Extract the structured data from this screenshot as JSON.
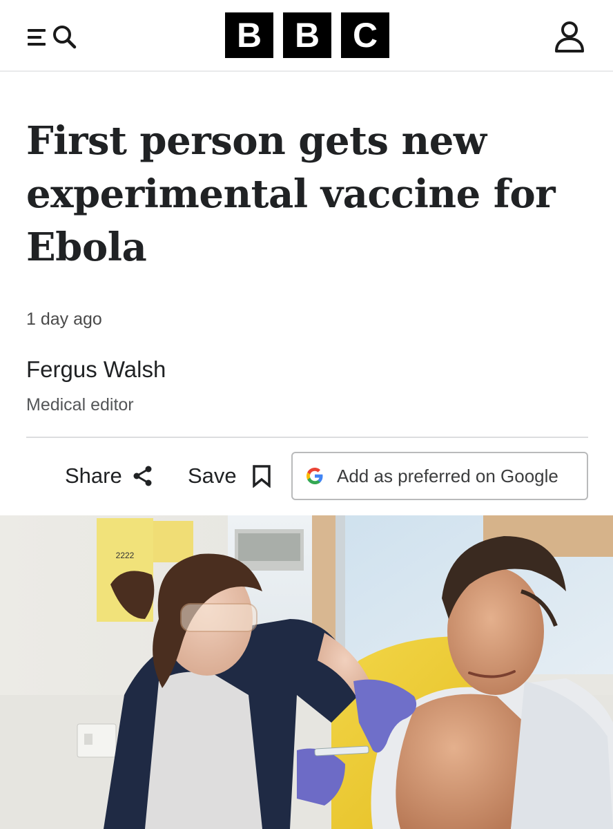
{
  "header": {
    "menu_icon": "hamburger-menu-icon",
    "search_icon": "search-icon",
    "logo_letters": [
      "B",
      "B",
      "C"
    ],
    "account_icon": "user-account-icon"
  },
  "article": {
    "headline": "First person gets new experimental vaccine for Ebola",
    "timestamp": "1 day ago",
    "author_name": "Fergus Walsh",
    "author_role": "Medical editor"
  },
  "actions": {
    "share_label": "Share",
    "share_icon": "share-icon",
    "save_label": "Save",
    "save_icon": "bookmark-icon",
    "google_label": "Add as preferred on Google",
    "google_icon": "google-g-icon"
  },
  "photo": {
    "sign_number": "2222"
  }
}
